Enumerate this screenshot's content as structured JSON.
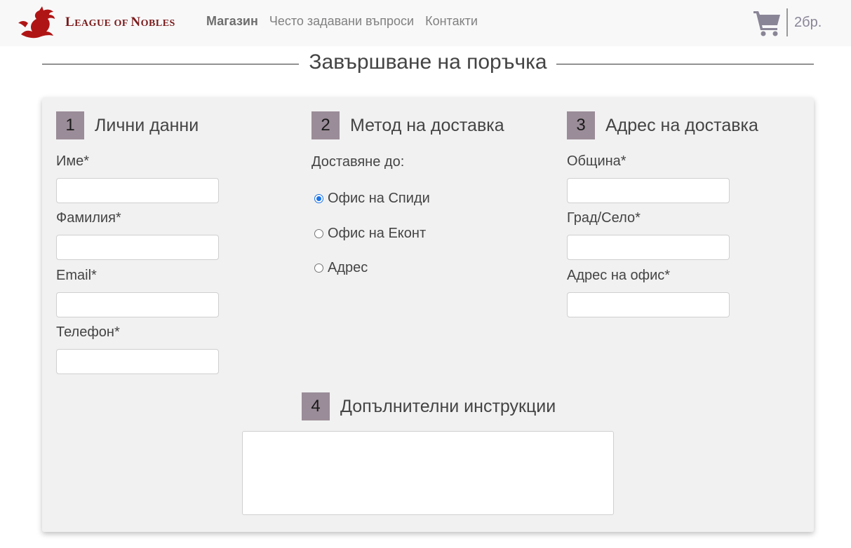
{
  "brand": {
    "name_first": "L",
    "name_rest": "EAGUE OF ",
    "name_first2": "N",
    "name_rest2": "OBLES",
    "logo_icon": "dragon-icon",
    "color": "#7a1a1a"
  },
  "nav": {
    "items": [
      {
        "label": "Магазин",
        "active": true
      },
      {
        "label": "Често задавани въпроси",
        "active": false
      },
      {
        "label": "Контакти",
        "active": false
      }
    ]
  },
  "cart": {
    "icon": "shopping-cart-icon",
    "count_label": "2бр."
  },
  "page_title": "Завършване на поръчка",
  "sections": {
    "personal": {
      "number": "1",
      "title": "Лични данни",
      "fields": [
        {
          "label": "Име*",
          "value": ""
        },
        {
          "label": "Фамилия*",
          "value": ""
        },
        {
          "label": "Email*",
          "value": ""
        },
        {
          "label": "Телефон*",
          "value": ""
        }
      ]
    },
    "delivery": {
      "number": "2",
      "title": "Метод на доставка",
      "prompt": "Доставяне до:",
      "options": [
        {
          "label": "Офис на Спиди",
          "checked": true
        },
        {
          "label": "Офис на Еконт",
          "checked": false
        },
        {
          "label": "Адрес",
          "checked": false
        }
      ]
    },
    "address": {
      "number": "3",
      "title": "Адрес на доставка",
      "fields": [
        {
          "label": "Община*",
          "value": ""
        },
        {
          "label": "Град/Село*",
          "value": ""
        },
        {
          "label": "Адрес на офис*",
          "value": ""
        }
      ]
    },
    "instructions": {
      "number": "4",
      "title": "Допълнителни инструкции",
      "value": ""
    }
  },
  "colors": {
    "accent": "#9a8c98",
    "navbar_bg": "#f8f8f9",
    "panel_bg": "#f1f1f1",
    "radio_checked": "#1a73e8"
  }
}
